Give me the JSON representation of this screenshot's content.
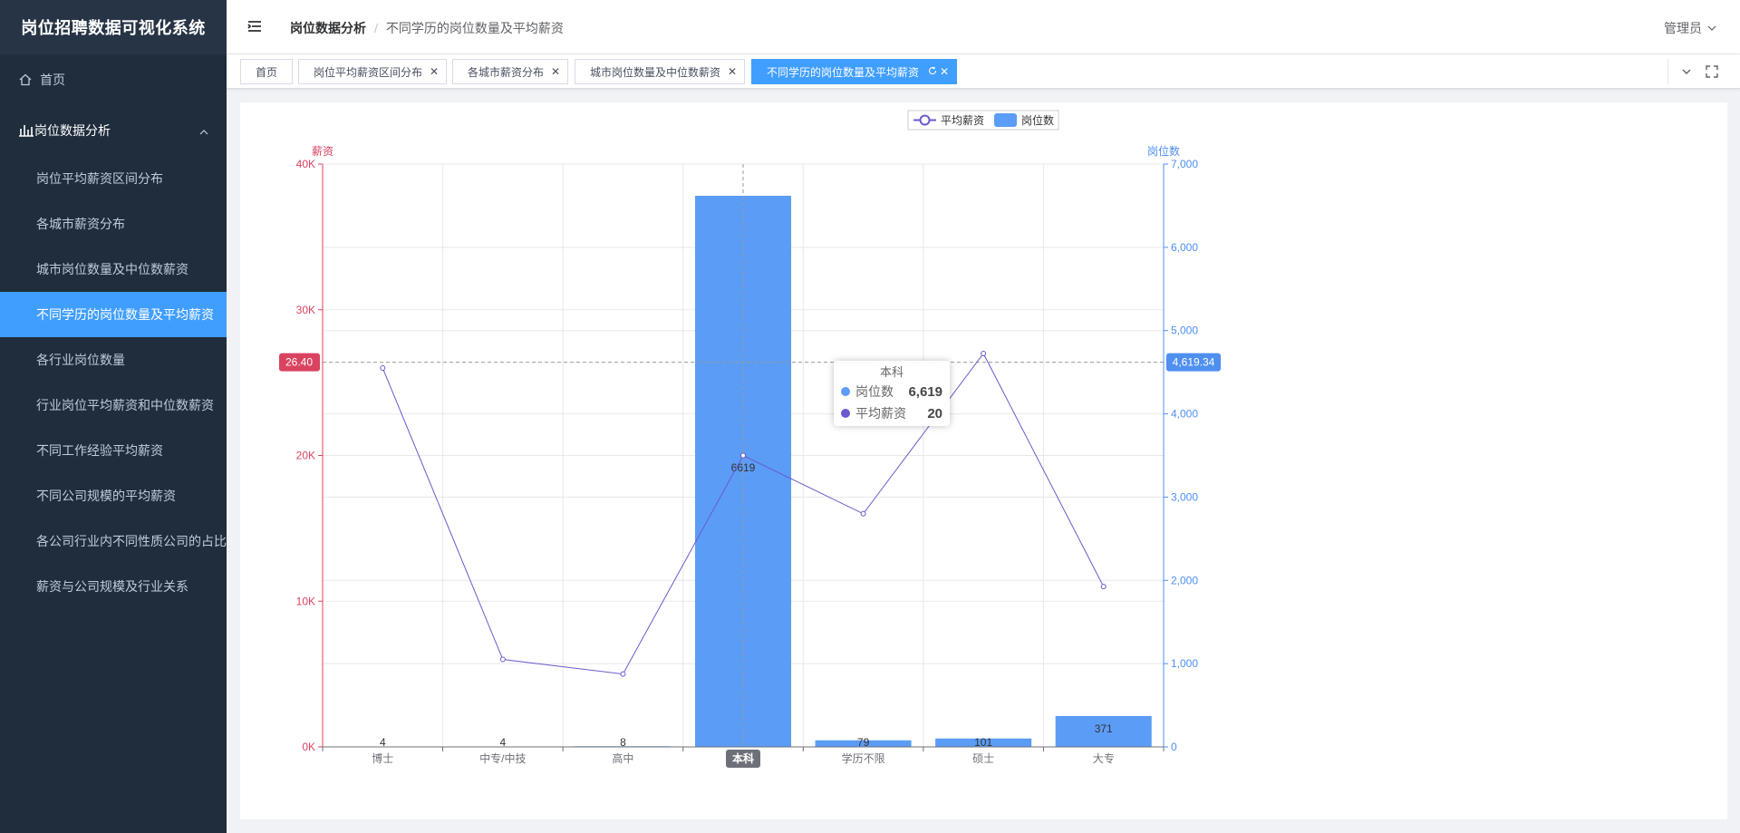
{
  "app": {
    "title": "岗位招聘数据可视化系统"
  },
  "sidebar": {
    "home_label": "首页",
    "group_label": "岗位数据分析",
    "items": [
      {
        "label": "岗位平均薪资区间分布"
      },
      {
        "label": "各城市薪资分布"
      },
      {
        "label": "城市岗位数量及中位数薪资"
      },
      {
        "label": "不同学历的岗位数量及平均薪资",
        "active": true
      },
      {
        "label": "各行业岗位数量"
      },
      {
        "label": "行业岗位平均薪资和中位数薪资"
      },
      {
        "label": "不同工作经验平均薪资"
      },
      {
        "label": "不同公司规模的平均薪资"
      },
      {
        "label": "各公司行业内不同性质公司的占比"
      },
      {
        "label": "薪资与公司规模及行业关系"
      }
    ]
  },
  "navbar": {
    "breadcrumb_main": "岗位数据分析",
    "breadcrumb_sep": "/",
    "breadcrumb_current": "不同学历的岗位数量及平均薪资",
    "user_label": "管理员"
  },
  "tags": [
    {
      "label": "首页",
      "closable": false
    },
    {
      "label": "岗位平均薪资区间分布",
      "closable": true
    },
    {
      "label": "各城市薪资分布",
      "closable": true
    },
    {
      "label": "城市岗位数量及中位数薪资",
      "closable": true
    },
    {
      "label": "不同学历的岗位数量及平均薪资",
      "closable": true,
      "active": true
    }
  ],
  "colors": {
    "sidebar_bg": "#1f2d3d",
    "accent": "#409eff",
    "bar": "#5b9cf6",
    "line": "#6a5acd",
    "left_axis": "#d9435f",
    "right_axis": "#4f8ff0"
  },
  "chart_data": {
    "type": "bar",
    "categories": [
      "博士",
      "中专/中技",
      "高中",
      "本科",
      "学历不限",
      "硕士",
      "大专"
    ],
    "series": [
      {
        "name": "岗位数",
        "type": "bar",
        "axis": "right",
        "values": [
          4,
          4,
          8,
          6619,
          79,
          101,
          371
        ],
        "labels": [
          "4",
          "4",
          "8",
          "6619",
          "79",
          "101",
          "371"
        ]
      },
      {
        "name": "平均薪资",
        "type": "line",
        "axis": "left",
        "values": [
          26000,
          6000,
          5000,
          20000,
          16000,
          27000,
          11000
        ]
      }
    ],
    "left_axis": {
      "label": "薪资",
      "range": [
        0,
        40000
      ],
      "ticks": [
        "0K",
        "10K",
        "20K",
        "30K",
        "40K"
      ],
      "tick_values": [
        0,
        10000,
        20000,
        30000,
        40000
      ]
    },
    "right_axis": {
      "label": "岗位数",
      "range": [
        0,
        7000
      ],
      "ticks": [
        "0",
        "1,000",
        "2,000",
        "3,000",
        "4,000",
        "5,000",
        "6,000",
        "7,000"
      ],
      "tick_values": [
        0,
        1000,
        2000,
        3000,
        4000,
        5000,
        6000,
        7000
      ]
    },
    "legend": {
      "position": "top",
      "entries": [
        "平均薪资",
        "岗位数"
      ]
    },
    "grid": true,
    "crosshair": {
      "category": "本科",
      "left_label": "26.40",
      "left_value": 26400,
      "right_label": "4,619.34"
    },
    "tooltip": {
      "title": "本科",
      "rows": [
        {
          "name": "岗位数",
          "value": "6,619"
        },
        {
          "name": "平均薪资",
          "value": "20"
        }
      ]
    }
  }
}
